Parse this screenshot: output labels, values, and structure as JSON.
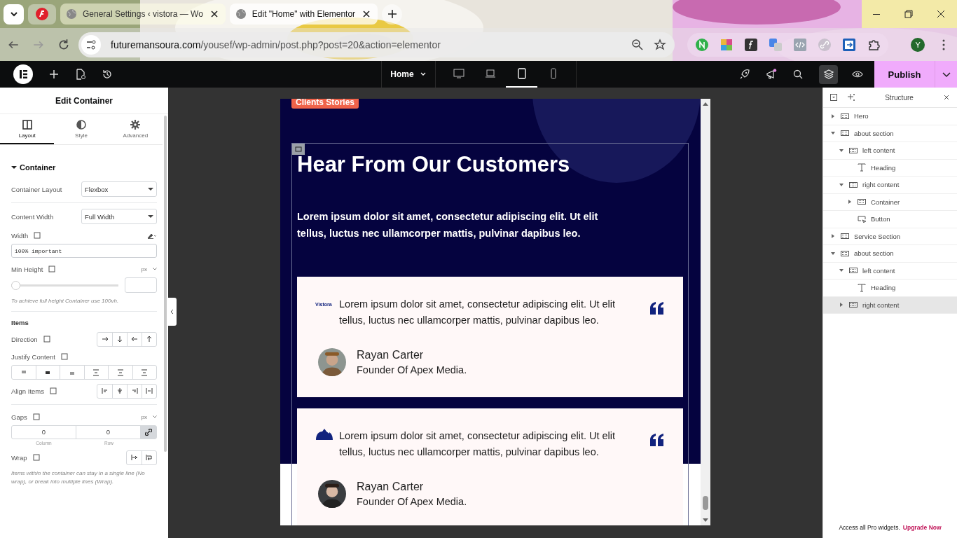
{
  "browser": {
    "tabs": [
      {
        "title": "General Settings ‹ vistora — Wo",
        "selected": false
      },
      {
        "title": "Edit \"Home\" with Elementor",
        "selected": true
      }
    ],
    "url_host": "futuremansoura.com",
    "url_path": "/yousef/wp-admin/post.php?post=20&action=elementor",
    "profile": "Y"
  },
  "toolbar": {
    "page": "Home",
    "devices": [
      {
        "kind": "desktop",
        "selected": false
      },
      {
        "kind": "laptop",
        "selected": false
      },
      {
        "kind": "tablet",
        "selected": true
      },
      {
        "kind": "mobile",
        "selected": false
      }
    ],
    "publish": "Publish"
  },
  "panel": {
    "title": "Edit Container",
    "tabs": [
      {
        "label": "Layout",
        "kind": "layout",
        "selected": true
      },
      {
        "label": "Style",
        "kind": "style",
        "selected": false
      },
      {
        "label": "Advanced",
        "kind": "advanced",
        "selected": false
      }
    ],
    "section": "Container",
    "container_layout": {
      "label": "Container Layout",
      "value": "Flexbox"
    },
    "content_width": {
      "label": "Content Width",
      "value": "Full Width"
    },
    "width": {
      "label": "Width",
      "value": "100% important"
    },
    "min_height": {
      "label": "Min Height",
      "unit": "px",
      "level": 0,
      "hint": "To achieve full height Container use 100vh."
    },
    "items_heading": "Items",
    "direction": "Direction",
    "justify": "Justify Content",
    "align": "Align Items",
    "gaps": {
      "label": "Gaps",
      "unit": "px",
      "column": "0",
      "row": "0",
      "column_label": "Column",
      "row_label": "Row",
      "linked": true
    },
    "wrap": {
      "label": "Wrap",
      "hint": "Items within the container can stay in a single line (No wrap), or break into multiple lines (Wrap)."
    }
  },
  "preview": {
    "badge": "Clients Stories",
    "heading": "Hear From Our Customers",
    "intro": "Lorem ipsum dolor sit amet, consectetur adipiscing elit. Ut elit tellus, luctus nec ullamcorper mattis, pulvinar dapibus leo.",
    "testimonials": [
      {
        "kind": "text_logo",
        "logo": "Vistora",
        "quote": "Lorem ipsum dolor sit amet, consectetur adipiscing elit. Ut elit tellus, luctus nec ullamcorper mattis, pulvinar dapibus leo.",
        "name": "Rayan Carter",
        "role": "Founder Of Apex Media."
      },
      {
        "kind": "shape_logo",
        "quote": "Lorem ipsum dolor sit amet, consectetur adipiscing elit. Ut elit tellus, luctus nec ullamcorper mattis, pulvinar dapibus leo.",
        "name": "Rayan Carter",
        "role": "Founder Of Apex Media."
      }
    ]
  },
  "structure": {
    "title": "Structure",
    "items": [
      {
        "label": "Hero",
        "kind": "container",
        "expanded": false,
        "selected": false
      },
      {
        "label": "about section",
        "kind": "container",
        "expanded": true,
        "selected": false,
        "children": [
          {
            "label": "left content",
            "kind": "container",
            "expanded": true,
            "selected": false,
            "children": [
              {
                "label": "Heading",
                "kind": "heading",
                "selected": false
              }
            ]
          },
          {
            "label": "right content",
            "kind": "container",
            "expanded": true,
            "selected": false,
            "children": [
              {
                "label": "Container",
                "kind": "container",
                "expanded": false,
                "selected": false
              },
              {
                "label": "Button",
                "kind": "button",
                "selected": false
              }
            ]
          }
        ]
      },
      {
        "label": "Service  Section",
        "kind": "container",
        "expanded": false,
        "selected": false
      },
      {
        "label": "about section",
        "kind": "container",
        "expanded": true,
        "selected": false,
        "children": [
          {
            "label": "left content",
            "kind": "container",
            "expanded": true,
            "selected": false,
            "children": [
              {
                "label": "Heading",
                "kind": "heading",
                "selected": false
              }
            ]
          },
          {
            "label": "right content",
            "kind": "container",
            "expanded": false,
            "selected": true
          }
        ]
      }
    ],
    "footer": "Access all Pro widgets.",
    "upgrade": "Upgrade Now"
  }
}
